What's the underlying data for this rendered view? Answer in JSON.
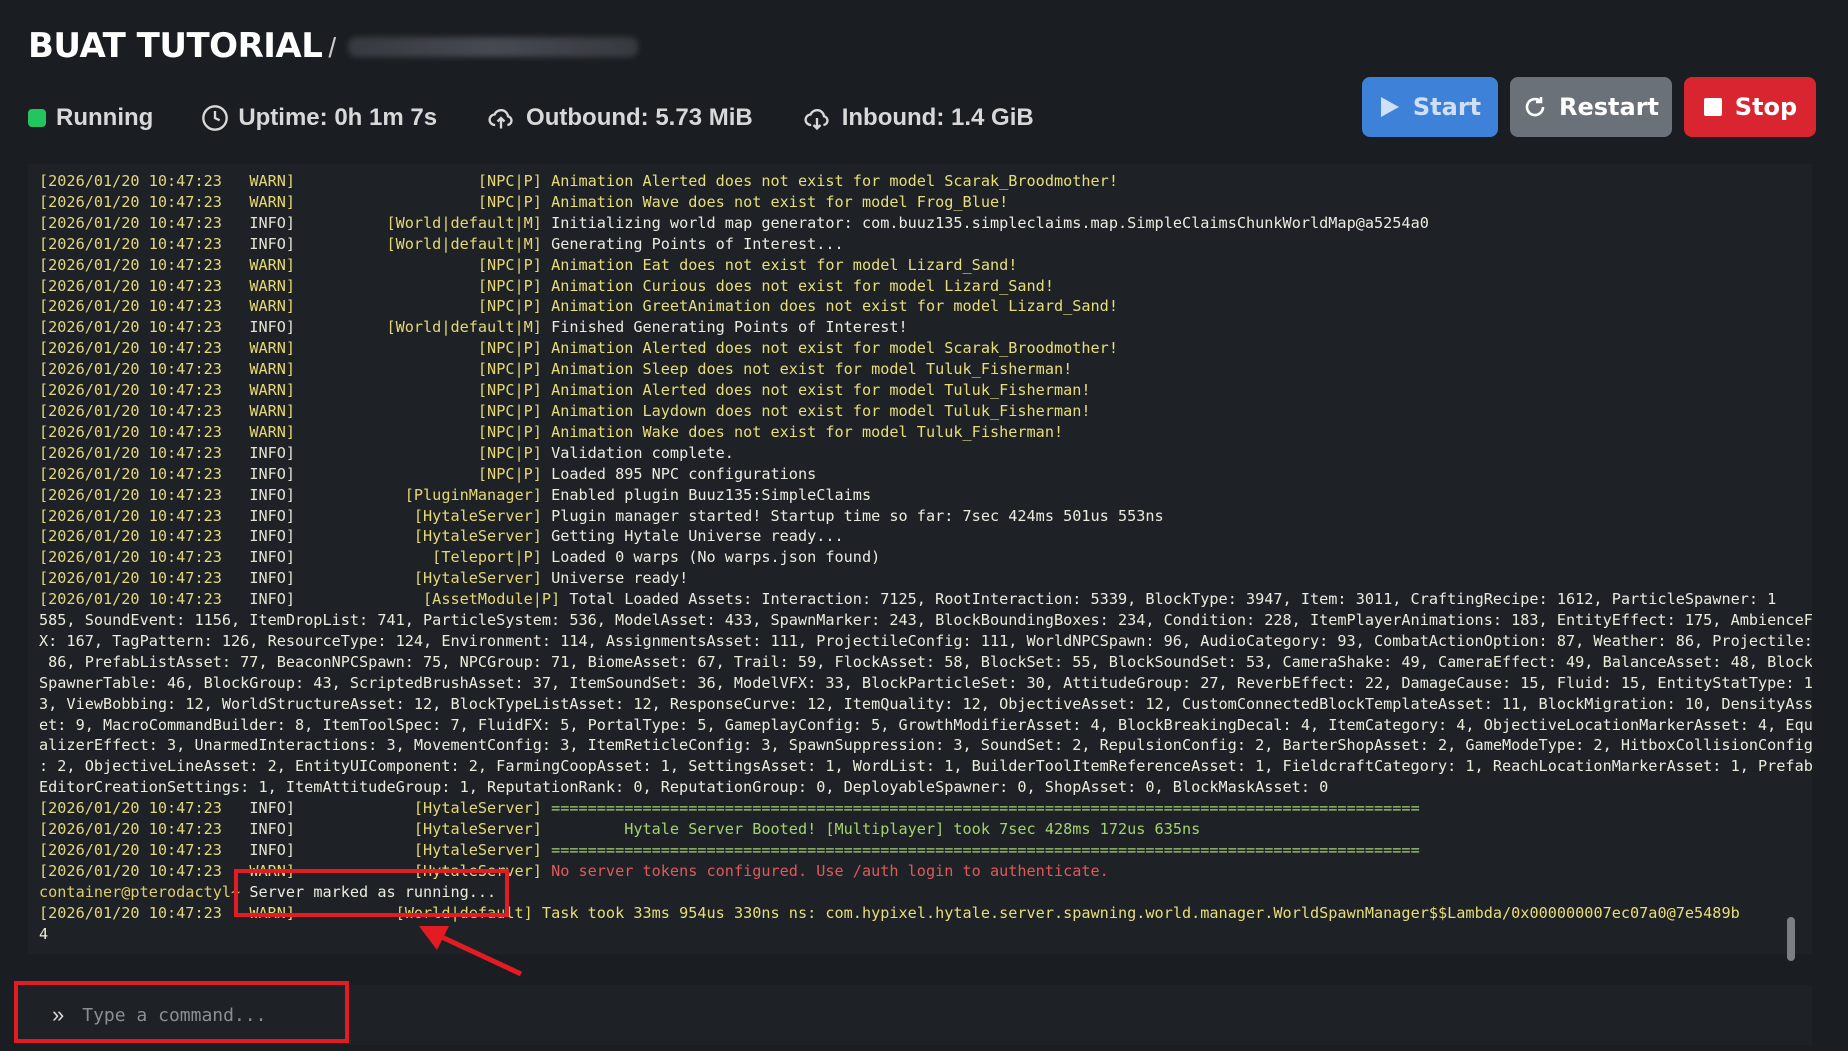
{
  "header": {
    "title": "BUAT TUTORIAL",
    "separator": "/"
  },
  "status": {
    "state": "Running",
    "uptime": "Uptime: 0h 1m 7s",
    "outbound": "Outbound: 5.73 MiB",
    "inbound": "Inbound: 1.4 GiB",
    "state_color": "#22c55e"
  },
  "buttons": {
    "start": "Start",
    "restart": "Restart",
    "stop": "Stop"
  },
  "console": {
    "lines": [
      {
        "ts": "[2026/01/20 10:47:23",
        "lvl": "WARN]",
        "tag": "                    [NPC|P]",
        "msg": " Animation Alerted does not exist for model Scarak_Broodmother!",
        "kind": "warn"
      },
      {
        "ts": "[2026/01/20 10:47:23",
        "lvl": "WARN]",
        "tag": "                    [NPC|P]",
        "msg": " Animation Wave does not exist for model Frog_Blue!",
        "kind": "warn"
      },
      {
        "ts": "[2026/01/20 10:47:23",
        "lvl": "INFO]",
        "tag": "          [World|default|M]",
        "msg": " Initializing world map generator: com.buuz135.simpleclaims.map.SimpleClaimsChunkWorldMap@a5254a0",
        "kind": "info"
      },
      {
        "ts": "[2026/01/20 10:47:23",
        "lvl": "INFO]",
        "tag": "          [World|default|M]",
        "msg": " Generating Points of Interest...",
        "kind": "info"
      },
      {
        "ts": "[2026/01/20 10:47:23",
        "lvl": "WARN]",
        "tag": "                    [NPC|P]",
        "msg": " Animation Eat does not exist for model Lizard_Sand!",
        "kind": "warn"
      },
      {
        "ts": "[2026/01/20 10:47:23",
        "lvl": "WARN]",
        "tag": "                    [NPC|P]",
        "msg": " Animation Curious does not exist for model Lizard_Sand!",
        "kind": "warn"
      },
      {
        "ts": "[2026/01/20 10:47:23",
        "lvl": "WARN]",
        "tag": "                    [NPC|P]",
        "msg": " Animation GreetAnimation does not exist for model Lizard_Sand!",
        "kind": "warn"
      },
      {
        "ts": "[2026/01/20 10:47:23",
        "lvl": "INFO]",
        "tag": "          [World|default|M]",
        "msg": " Finished Generating Points of Interest!",
        "kind": "info"
      },
      {
        "ts": "[2026/01/20 10:47:23",
        "lvl": "WARN]",
        "tag": "                    [NPC|P]",
        "msg": " Animation Alerted does not exist for model Scarak_Broodmother!",
        "kind": "warn"
      },
      {
        "ts": "[2026/01/20 10:47:23",
        "lvl": "WARN]",
        "tag": "                    [NPC|P]",
        "msg": " Animation Sleep does not exist for model Tuluk_Fisherman!",
        "kind": "warn"
      },
      {
        "ts": "[2026/01/20 10:47:23",
        "lvl": "WARN]",
        "tag": "                    [NPC|P]",
        "msg": " Animation Alerted does not exist for model Tuluk_Fisherman!",
        "kind": "warn"
      },
      {
        "ts": "[2026/01/20 10:47:23",
        "lvl": "WARN]",
        "tag": "                    [NPC|P]",
        "msg": " Animation Laydown does not exist for model Tuluk_Fisherman!",
        "kind": "warn"
      },
      {
        "ts": "[2026/01/20 10:47:23",
        "lvl": "WARN]",
        "tag": "                    [NPC|P]",
        "msg": " Animation Wake does not exist for model Tuluk_Fisherman!",
        "kind": "warn"
      },
      {
        "ts": "[2026/01/20 10:47:23",
        "lvl": "INFO]",
        "tag": "                    [NPC|P]",
        "msg": " Validation complete.",
        "kind": "info"
      },
      {
        "ts": "[2026/01/20 10:47:23",
        "lvl": "INFO]",
        "tag": "                    [NPC|P]",
        "msg": " Loaded 895 NPC configurations",
        "kind": "info"
      },
      {
        "ts": "[2026/01/20 10:47:23",
        "lvl": "INFO]",
        "tag": "            [PluginManager]",
        "msg": " Enabled plugin Buuz135:SimpleClaims",
        "kind": "info"
      },
      {
        "ts": "[2026/01/20 10:47:23",
        "lvl": "INFO]",
        "tag": "             [HytaleServer]",
        "msg": " Plugin manager started! Startup time so far: 7sec 424ms 501us 553ns",
        "kind": "info"
      },
      {
        "ts": "[2026/01/20 10:47:23",
        "lvl": "INFO]",
        "tag": "             [HytaleServer]",
        "msg": " Getting Hytale Universe ready...",
        "kind": "info"
      },
      {
        "ts": "[2026/01/20 10:47:23",
        "lvl": "INFO]",
        "tag": "               [Teleport|P]",
        "msg": " Loaded 0 warps (No warps.json found)",
        "kind": "info"
      },
      {
        "ts": "[2026/01/20 10:47:23",
        "lvl": "INFO]",
        "tag": "             [HytaleServer]",
        "msg": " Universe ready!",
        "kind": "info"
      },
      {
        "ts": "[2026/01/20 10:47:23",
        "lvl": "INFO]",
        "tag": "              [AssetModule|P]",
        "msg": " Total Loaded Assets: Interaction: 7125, RootInteraction: 5339, BlockType: 3947, Item: 3011, CraftingRecipe: 1612, ParticleSpawner: 1",
        "kind": "info"
      },
      {
        "cont": "585, SoundEvent: 1156, ItemDropList: 741, ParticleSystem: 536, ModelAsset: 433, SpawnMarker: 243, BlockBoundingBoxes: 234, Condition: 228, ItemPlayerAnimations: 183, EntityEffect: 175, AmbienceF"
      },
      {
        "cont": "X: 167, TagPattern: 126, ResourceType: 124, Environment: 114, AssignmentsAsset: 111, ProjectileConfig: 111, WorldNPCSpawn: 96, AudioCategory: 93, CombatActionOption: 87, Weather: 86, Projectile:"
      },
      {
        "cont": " 86, PrefabListAsset: 77, BeaconNPCSpawn: 75, NPCGroup: 71, BiomeAsset: 67, Trail: 59, FlockAsset: 58, BlockSet: 55, BlockSoundSet: 53, CameraShake: 49, CameraEffect: 49, BalanceAsset: 48, Block"
      },
      {
        "cont": "SpawnerTable: 46, BlockGroup: 43, ScriptedBrushAsset: 37, ItemSoundSet: 36, ModelVFX: 33, BlockParticleSet: 30, AttitudeGroup: 27, ReverbEffect: 22, DamageCause: 15, Fluid: 15, EntityStatType: 1"
      },
      {
        "cont": "3, ViewBobbing: 12, WorldStructureAsset: 12, BlockTypeListAsset: 12, ResponseCurve: 12, ItemQuality: 12, ObjectiveAsset: 12, CustomConnectedBlockTemplateAsset: 11, BlockMigration: 10, DensityAss"
      },
      {
        "cont": "et: 9, MacroCommandBuilder: 8, ItemToolSpec: 7, FluidFX: 5, PortalType: 5, GameplayConfig: 5, GrowthModifierAsset: 4, BlockBreakingDecal: 4, ItemCategory: 4, ObjectiveLocationMarkerAsset: 4, Equ"
      },
      {
        "cont": "alizerEffect: 3, UnarmedInteractions: 3, MovementConfig: 3, ItemReticleConfig: 3, SpawnSuppression: 3, SoundSet: 2, RepulsionConfig: 2, BarterShopAsset: 2, GameModeType: 2, HitboxCollisionConfig"
      },
      {
        "cont": ": 2, ObjectiveLineAsset: 2, EntityUIComponent: 2, FarmingCoopAsset: 1, SettingsAsset: 1, WordList: 1, BuilderToolItemReferenceAsset: 1, FieldcraftCategory: 1, ReachLocationMarkerAsset: 1, Prefab"
      },
      {
        "cont": "EditorCreationSettings: 1, ItemAttitudeGroup: 1, ReputationRank: 0, ReputationGroup: 0, DeployableSpawner: 0, ShopAsset: 0, BlockMaskAsset: 0"
      },
      {
        "ts": "[2026/01/20 10:47:23",
        "lvl": "INFO]",
        "tag": "             [HytaleServer]",
        "msg": " ===============================================================================================",
        "kind": "green"
      },
      {
        "ts": "[2026/01/20 10:47:23",
        "lvl": "INFO]",
        "tag": "             [HytaleServer]",
        "msg": "         Hytale Server Booted! [Multiplayer] took 7sec 428ms 172us 635ns",
        "kind": "green"
      },
      {
        "ts": "[2026/01/20 10:47:23",
        "lvl": "INFO]",
        "tag": "             [HytaleServer]",
        "msg": " ===============================================================================================",
        "kind": "green"
      },
      {
        "ts": "[2026/01/20 10:47:23",
        "lvl": "WARN]",
        "tag": "             [HytaleServer]",
        "msg": " No server tokens configured. Use /auth login to authenticate.",
        "kind": "red"
      },
      {
        "prompt": "container@pterodactyl~",
        "pmsg": " Server marked as running..."
      },
      {
        "ts": "[2026/01/20 10:47:23",
        "lvl": "WARN]",
        "tag": "           [World|default]",
        "msg": " Task took 33ms 954us 330ns ns: com.hypixel.hytale.server.spawning.world.manager.WorldSpawnManager$$Lambda/0x000000007ec07a0@7e5489b",
        "kind": "warn"
      },
      {
        "cont": "4"
      }
    ]
  },
  "command": {
    "placeholder": "Type a command...",
    "icon": "double-chevron-right-icon"
  },
  "colors": {
    "start": "#3d82d8",
    "restart": "#6b7178",
    "stop": "#d9252f",
    "highlight": "#e31b23"
  }
}
